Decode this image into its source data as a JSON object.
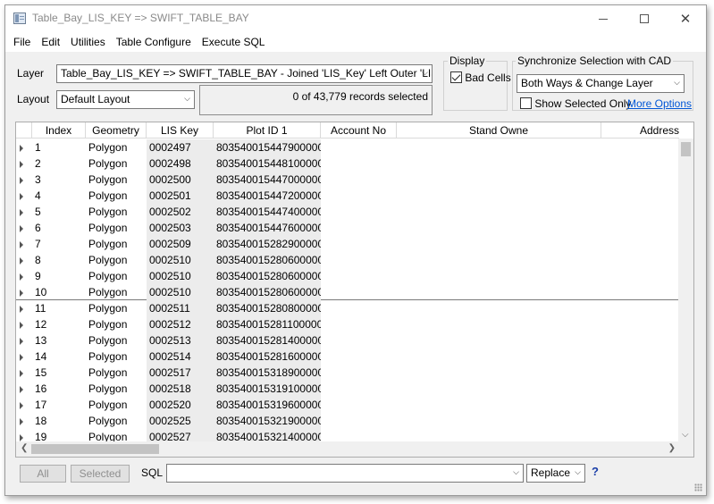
{
  "window": {
    "title": "Table_Bay_LIS_KEY => SWIFT_TABLE_BAY",
    "minimize_glyph": "",
    "maximize_glyph": "",
    "close_glyph": "✕"
  },
  "menu": [
    "File",
    "Edit",
    "Utilities",
    "Table Configure",
    "Execute SQL"
  ],
  "toolbar": {
    "layer_label": "Layer",
    "layer_value": "Table_Bay_LIS_KEY => SWIFT_TABLE_BAY - Joined 'LIS_Key' Left Outer 'LIS_Key'",
    "layout_label": "Layout",
    "layout_value": "Default Layout",
    "selection_count": "0 of 43,779 records selected"
  },
  "display": {
    "group_label": "Display",
    "bad_cells_label": "Bad Cells",
    "bad_cells_checked": true
  },
  "sync": {
    "group_label": "Synchronize Selection with CAD",
    "mode_value": "Both Ways & Change Layer",
    "show_selected_only_label": "Show Selected Only",
    "show_selected_only_checked": false,
    "more_options_label": "More Options"
  },
  "table": {
    "columns": [
      "Index",
      "Geometry",
      "LIS Key",
      "Plot ID 1",
      "Account No",
      "Stand Owne",
      "Address"
    ],
    "rows": [
      {
        "index": "1",
        "geometry": "Polygon",
        "lis_key": "0002497",
        "plot_id": "803540015447900000"
      },
      {
        "index": "2",
        "geometry": "Polygon",
        "lis_key": "0002498",
        "plot_id": "803540015448100000"
      },
      {
        "index": "3",
        "geometry": "Polygon",
        "lis_key": "0002500",
        "plot_id": "803540015447000000"
      },
      {
        "index": "4",
        "geometry": "Polygon",
        "lis_key": "0002501",
        "plot_id": "803540015447200000"
      },
      {
        "index": "5",
        "geometry": "Polygon",
        "lis_key": "0002502",
        "plot_id": "803540015447400000"
      },
      {
        "index": "6",
        "geometry": "Polygon",
        "lis_key": "0002503",
        "plot_id": "803540015447600000"
      },
      {
        "index": "7",
        "geometry": "Polygon",
        "lis_key": "0002509",
        "plot_id": "803540015282900000"
      },
      {
        "index": "8",
        "geometry": "Polygon",
        "lis_key": "0002510",
        "plot_id": "803540015280600000"
      },
      {
        "index": "9",
        "geometry": "Polygon",
        "lis_key": "0002510",
        "plot_id": "803540015280600000"
      },
      {
        "index": "10",
        "geometry": "Polygon",
        "lis_key": "0002510",
        "plot_id": "803540015280600000"
      },
      {
        "index": "11",
        "geometry": "Polygon",
        "lis_key": "0002511",
        "plot_id": "803540015280800000"
      },
      {
        "index": "12",
        "geometry": "Polygon",
        "lis_key": "0002512",
        "plot_id": "803540015281100000"
      },
      {
        "index": "13",
        "geometry": "Polygon",
        "lis_key": "0002513",
        "plot_id": "803540015281400000"
      },
      {
        "index": "14",
        "geometry": "Polygon",
        "lis_key": "0002514",
        "plot_id": "803540015281600000"
      },
      {
        "index": "15",
        "geometry": "Polygon",
        "lis_key": "0002517",
        "plot_id": "803540015318900000"
      },
      {
        "index": "16",
        "geometry": "Polygon",
        "lis_key": "0002518",
        "plot_id": "803540015319100000"
      },
      {
        "index": "17",
        "geometry": "Polygon",
        "lis_key": "0002520",
        "plot_id": "803540015319600000"
      },
      {
        "index": "18",
        "geometry": "Polygon",
        "lis_key": "0002525",
        "plot_id": "803540015321900000"
      },
      {
        "index": "19",
        "geometry": "Polygon",
        "lis_key": "0002527",
        "plot_id": "803540015321400000"
      }
    ]
  },
  "bottom": {
    "all_label": "All",
    "selected_label": "Selected",
    "sql_label": "SQL",
    "sql_value": "",
    "replace_value": "Replace",
    "help_label": "?"
  },
  "colors": {
    "link": "#0056d6",
    "window_bg": "#f0f0f0",
    "shaded_cell": "#ececec"
  }
}
